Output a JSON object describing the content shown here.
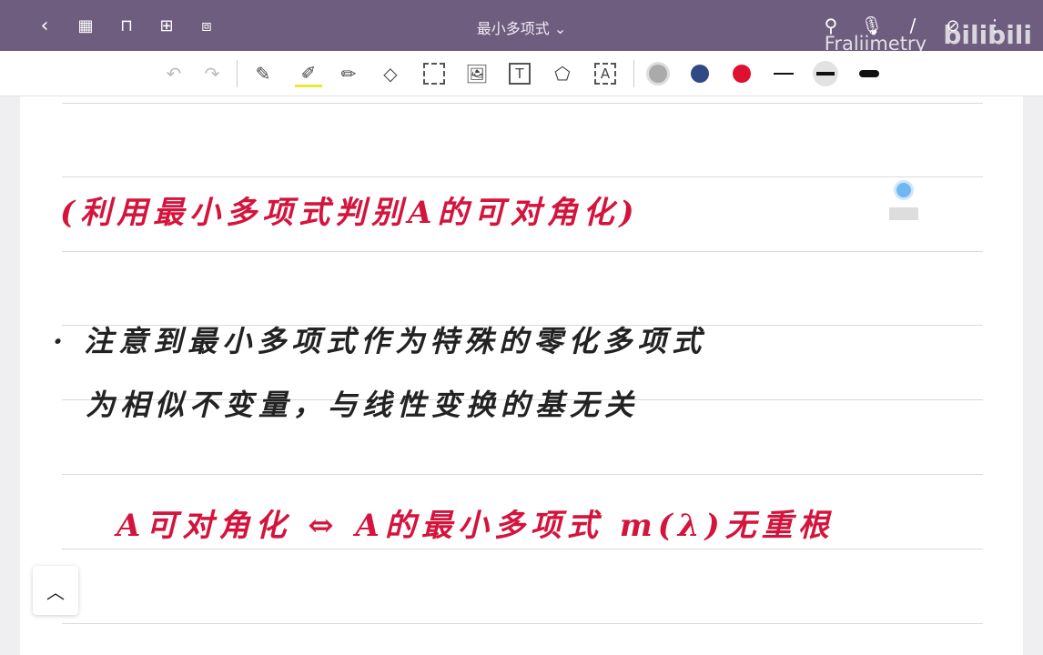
{
  "header": {
    "title": "最小多项式",
    "title_chevron": "⌄",
    "watermark": "Fraliimetry",
    "brand": "bilibili"
  },
  "notes": {
    "line1": "(利用最小多项式判别A的可对角化)",
    "line2": "· 注意到最小多项式作为特殊的零化多项式",
    "line3": "为相似不变量，与线性变换的基无关",
    "line4": "A可对角化 ⇔ A的最小多项式 m(λ)无重根"
  },
  "colors": {
    "red": "#d4143c",
    "blue": "#2f4a85",
    "gray": "#aaaaaa",
    "header": "#6e5d7e"
  }
}
